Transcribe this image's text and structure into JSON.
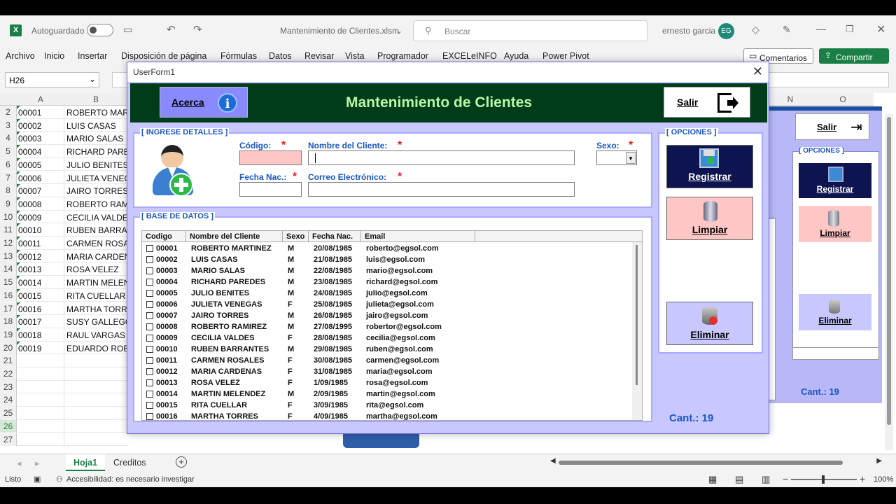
{
  "excel": {
    "autosave_label": "Autoguardado",
    "filename": "Mantenimiento de Clientes.xlsm",
    "search_placeholder": "Buscar",
    "user_name": "ernesto garcia",
    "user_initials": "EG",
    "menu": [
      "Archivo",
      "Inicio",
      "Insertar",
      "Disposición de página",
      "Fórmulas",
      "Datos",
      "Revisar",
      "Vista",
      "Programador",
      "EXCELeINFO",
      "Ayuda",
      "Power Pivot"
    ],
    "comments_label": "Comentarios",
    "share_label": "Compartir",
    "name_box": "H26",
    "columns": [
      "A",
      "B",
      "N",
      "O"
    ],
    "rows": [
      {
        "n": "2",
        "a": "00001",
        "b": "ROBERTO MARTINEZ"
      },
      {
        "n": "3",
        "a": "00002",
        "b": "LUIS CASAS"
      },
      {
        "n": "4",
        "a": "00003",
        "b": "MARIO SALAS"
      },
      {
        "n": "5",
        "a": "00004",
        "b": "RICHARD PAREDES"
      },
      {
        "n": "6",
        "a": "00005",
        "b": "JULIO BENITES"
      },
      {
        "n": "7",
        "a": "00006",
        "b": "JULIETA VENEGAS"
      },
      {
        "n": "8",
        "a": "00007",
        "b": "JAIRO TORRES"
      },
      {
        "n": "9",
        "a": "00008",
        "b": "ROBERTO RAMIREZ"
      },
      {
        "n": "10",
        "a": "00009",
        "b": "CECILIA VALDES"
      },
      {
        "n": "11",
        "a": "00010",
        "b": "RUBEN BARRANTES"
      },
      {
        "n": "12",
        "a": "00011",
        "b": "CARMEN ROSALES"
      },
      {
        "n": "13",
        "a": "00012",
        "b": "MARIA CARDENAS"
      },
      {
        "n": "14",
        "a": "00013",
        "b": "ROSA VELEZ"
      },
      {
        "n": "15",
        "a": "00014",
        "b": "MARTIN MELENDEZ"
      },
      {
        "n": "16",
        "a": "00015",
        "b": "RITA CUELLAR"
      },
      {
        "n": "17",
        "a": "00016",
        "b": "MARTHA TORRES"
      },
      {
        "n": "18",
        "a": "00017",
        "b": "SUSY GALLEGOS"
      },
      {
        "n": "19",
        "a": "00018",
        "b": "RAUL VARGAS"
      },
      {
        "n": "20",
        "a": "00019",
        "b": "EDUARDO ROBLES"
      },
      {
        "n": "21",
        "a": "",
        "b": ""
      },
      {
        "n": "22",
        "a": "",
        "b": ""
      },
      {
        "n": "23",
        "a": "",
        "b": ""
      },
      {
        "n": "24",
        "a": "",
        "b": ""
      },
      {
        "n": "25",
        "a": "",
        "b": ""
      },
      {
        "n": "26",
        "a": "",
        "b": ""
      },
      {
        "n": "27",
        "a": "",
        "b": ""
      }
    ],
    "sheet_tabs": [
      "Hoja1",
      "Creditos"
    ],
    "status": "Listo",
    "accessibility": "Accesibilidad: es necesario investigar",
    "zoom": "100%"
  },
  "ghost": {
    "salir": "Salir",
    "opciones": "[ OPCIONES ]",
    "registrar": "Registrar",
    "limpiar": "Limpiar",
    "eliminar": "Eliminar",
    "cant": "Cant.: 19"
  },
  "form": {
    "title": "UserForm1",
    "acerca": "Acerca",
    "heading": "Mantenimiento de Clientes",
    "salir": "Salir",
    "details_caption": "[ INGRESE DETALLES ]",
    "lbl_codigo": "Código:",
    "lbl_nombre": "Nombre del Cliente:",
    "lbl_sexo": "Sexo:",
    "lbl_fecha": "Fecha Nac.:",
    "lbl_email": "Correo Electrónico:",
    "db_caption": "[ BASE DE DATOS ]",
    "headers": [
      "Codigo",
      "Nombre del Cliente",
      "Sexo",
      "Fecha Nac.",
      "Email"
    ],
    "records": [
      [
        "00001",
        "ROBERTO MARTINEZ",
        "M",
        "20/08/1985",
        "roberto@egsol.com"
      ],
      [
        "00002",
        "LUIS CASAS",
        "M",
        "21/08/1985",
        "luis@egsol.com"
      ],
      [
        "00003",
        "MARIO SALAS",
        "M",
        "22/08/1985",
        "mario@egsol.com"
      ],
      [
        "00004",
        "RICHARD PAREDES",
        "M",
        "23/08/1985",
        "richard@egsol.com"
      ],
      [
        "00005",
        "JULIO BENITES",
        "M",
        "24/08/1985",
        "julio@egsol.com"
      ],
      [
        "00006",
        "JULIETA VENEGAS",
        "F",
        "25/08/1985",
        "julieta@egsol.com"
      ],
      [
        "00007",
        "JAIRO TORRES",
        "M",
        "26/08/1985",
        "jairo@egsol.com"
      ],
      [
        "00008",
        "ROBERTO RAMIREZ",
        "M",
        "27/08/1995",
        "robertor@egsol.com"
      ],
      [
        "00009",
        "CECILIA VALDES",
        "F",
        "28/08/1985",
        "cecilia@egsol.com"
      ],
      [
        "00010",
        "RUBEN BARRANTES",
        "M",
        "29/08/1985",
        "ruben@egsol.com"
      ],
      [
        "00011",
        "CARMEN ROSALES",
        "F",
        "30/08/1985",
        "carmen@egsol.com"
      ],
      [
        "00012",
        "MARIA CARDENAS",
        "F",
        "31/08/1985",
        "maria@egsol.com"
      ],
      [
        "00013",
        "ROSA VELEZ",
        "F",
        "1/09/1985",
        "rosa@egsol.com"
      ],
      [
        "00014",
        "MARTIN MELENDEZ",
        "M",
        "2/09/1985",
        "martin@egsol.com"
      ],
      [
        "00015",
        "RITA CUELLAR",
        "F",
        "3/09/1985",
        "rita@egsol.com"
      ],
      [
        "00016",
        "MARTHA TORRES",
        "F",
        "4/09/1985",
        "martha@egsol.com"
      ]
    ],
    "opciones_caption": "[ OPCIONES ]",
    "registrar": "Registrar",
    "limpiar": "Limpiar",
    "eliminar": "Eliminar",
    "cant": "Cant.: 19"
  },
  "colors": {
    "banner": "#003b1a",
    "heading": "#b6f9a4",
    "accent": "#1a56c4",
    "form_bg": "#c8c8ff",
    "registrar_bg": "#0e1450",
    "limpiar_bg": "#ffc6c6",
    "eliminar_bg": "#c8c8ff"
  }
}
